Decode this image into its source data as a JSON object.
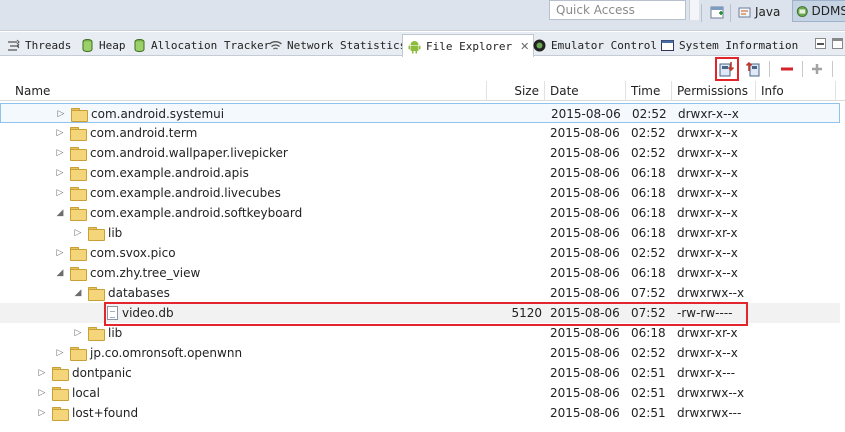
{
  "top": {
    "quick_access_placeholder": "Quick Access",
    "perspectives": [
      {
        "label": "Java",
        "icon": "java-perspective-icon"
      },
      {
        "label": "DDMS",
        "icon": "ddms-perspective-icon"
      }
    ]
  },
  "tabs": [
    {
      "label": "Threads",
      "icon": "threads-icon",
      "active": false
    },
    {
      "label": "Heap",
      "icon": "heap-icon",
      "active": false
    },
    {
      "label": "Allocation Tracker",
      "icon": "allocation-tracker-icon",
      "active": false
    },
    {
      "label": "Network Statistics",
      "icon": "network-icon",
      "active": false
    },
    {
      "label": "File Explorer",
      "icon": "android-icon",
      "active": true,
      "close": "✕"
    },
    {
      "label": "Emulator Control",
      "icon": "emulator-icon",
      "active": false
    },
    {
      "label": "System Information",
      "icon": "system-info-icon",
      "active": false
    }
  ],
  "toolbar": {
    "pull_icon": "pull-file-icon",
    "push_icon": "push-file-icon",
    "delete_icon": "delete-icon",
    "new_folder_icon": "add-icon"
  },
  "columns": [
    "Name",
    "Size",
    "Date",
    "Time",
    "Permissions",
    "Info"
  ],
  "rows": [
    {
      "name": "com.android.systemui",
      "size": "",
      "date": "2015-08-06",
      "time": "02:52",
      "perm": "drwxr-x--x",
      "kind": "folder",
      "expanded": false,
      "level": 2,
      "selected": true
    },
    {
      "name": "com.android.term",
      "size": "",
      "date": "2015-08-06",
      "time": "02:52",
      "perm": "drwxr-x--x",
      "kind": "folder",
      "expanded": false,
      "level": 2
    },
    {
      "name": "com.android.wallpaper.livepicker",
      "size": "",
      "date": "2015-08-06",
      "time": "02:52",
      "perm": "drwxr-x--x",
      "kind": "folder",
      "expanded": false,
      "level": 2
    },
    {
      "name": "com.example.android.apis",
      "size": "",
      "date": "2015-08-06",
      "time": "06:18",
      "perm": "drwxr-x--x",
      "kind": "folder",
      "expanded": false,
      "level": 2
    },
    {
      "name": "com.example.android.livecubes",
      "size": "",
      "date": "2015-08-06",
      "time": "06:18",
      "perm": "drwxr-x--x",
      "kind": "folder",
      "expanded": false,
      "level": 2
    },
    {
      "name": "com.example.android.softkeyboard",
      "size": "",
      "date": "2015-08-06",
      "time": "06:18",
      "perm": "drwxr-x--x",
      "kind": "folder",
      "expanded": true,
      "level": 2
    },
    {
      "name": "lib",
      "size": "",
      "date": "2015-08-06",
      "time": "06:18",
      "perm": "drwxr-xr-x",
      "kind": "folder",
      "expanded": false,
      "level": 3
    },
    {
      "name": "com.svox.pico",
      "size": "",
      "date": "2015-08-06",
      "time": "02:52",
      "perm": "drwxr-x--x",
      "kind": "folder",
      "expanded": false,
      "level": 2
    },
    {
      "name": "com.zhy.tree_view",
      "size": "",
      "date": "2015-08-06",
      "time": "06:18",
      "perm": "drwxr-x--x",
      "kind": "folder",
      "expanded": true,
      "level": 2
    },
    {
      "name": "databases",
      "size": "",
      "date": "2015-08-06",
      "time": "07:52",
      "perm": "drwxrwx--x",
      "kind": "folder",
      "expanded": true,
      "level": 3
    },
    {
      "name": "video.db",
      "size": "5120",
      "date": "2015-08-06",
      "time": "07:52",
      "perm": "-rw-rw----",
      "kind": "file",
      "level": 4,
      "focused": true
    },
    {
      "name": "lib",
      "size": "",
      "date": "2015-08-06",
      "time": "06:18",
      "perm": "drwxr-xr-x",
      "kind": "folder",
      "expanded": false,
      "level": 3
    },
    {
      "name": "jp.co.omronsoft.openwnn",
      "size": "",
      "date": "2015-08-06",
      "time": "02:52",
      "perm": "drwxr-x--x",
      "kind": "folder",
      "expanded": false,
      "level": 2
    },
    {
      "name": "dontpanic",
      "size": "",
      "date": "2015-08-06",
      "time": "02:51",
      "perm": "drwxr-x---",
      "kind": "folder",
      "expanded": false,
      "level": 1
    },
    {
      "name": "local",
      "size": "",
      "date": "2015-08-06",
      "time": "02:51",
      "perm": "drwxrwx--x",
      "kind": "folder",
      "expanded": false,
      "level": 1
    },
    {
      "name": "lost+found",
      "size": "",
      "date": "2015-08-06",
      "time": "02:51",
      "perm": "drwxrwx---",
      "kind": "folder",
      "expanded": false,
      "level": 1
    }
  ]
}
